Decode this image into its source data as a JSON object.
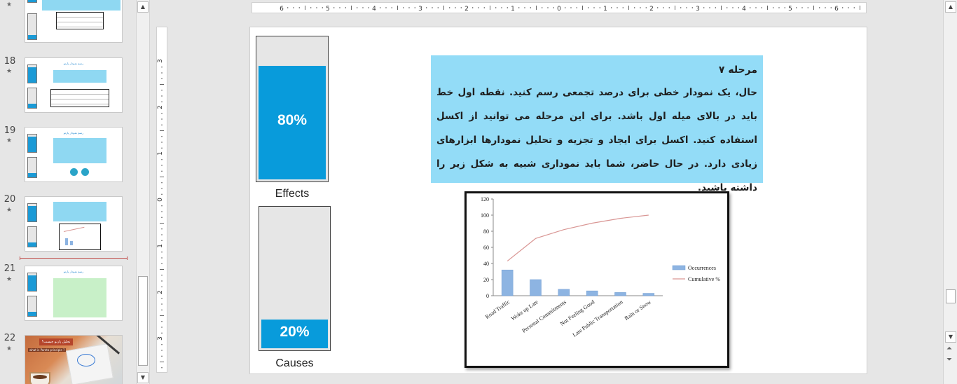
{
  "thumbnails": [
    {
      "num": "",
      "title": ""
    },
    {
      "num": "18",
      "title": "رسم نمودار پارتو"
    },
    {
      "num": "19",
      "title": "رسم نمودار پارتو"
    },
    {
      "num": "20",
      "title": ""
    },
    {
      "num": "21",
      "title": "رسم نمودار پارتو"
    },
    {
      "num": "22",
      "title": "تحلیل پارتو چیست؟",
      "subtitle": "what is Pareto principle ?"
    }
  ],
  "ruler": {
    "h_ticks": [
      "6",
      "5",
      "4",
      "3",
      "2",
      "1",
      "0",
      "1",
      "2",
      "3",
      "4",
      "5",
      "6"
    ],
    "v_ticks": [
      "3",
      "2",
      "1",
      "0",
      "1",
      "2",
      "3"
    ]
  },
  "slide": {
    "effects_bar": {
      "percent": "80%",
      "fill_fraction": 0.8,
      "label": "Effects"
    },
    "causes_bar": {
      "percent": "20%",
      "fill_fraction": 0.2,
      "label": "Causes"
    },
    "text": {
      "heading": "مرحله ۷",
      "body": "حال، یک نمودار خطی برای درصد تجمعی رسم کنید. نقطه اول خط باید در بالای میله اول باشد. برای این مرحله می توانید از اکسل استفاده کنید. اکسل برای ایجاد و تجزیه و تحلیل نمودارها ابزارهای زیادی دارد. در حال حاضر، شما باید نموداری شبیه به شکل زیر را داشته باشید."
    }
  },
  "chart_data": {
    "type": "bar",
    "categories": [
      "Road Traffic",
      "Woke up Late",
      "Personal Commitments",
      "Not Feeling Good",
      "Late Public Transportation",
      "Rain or Snow"
    ],
    "series": [
      {
        "name": "Occurrences",
        "type": "bar",
        "values": [
          32,
          20,
          8,
          6,
          4,
          3
        ],
        "color": "#8db4e2"
      },
      {
        "name": "Cumulative %",
        "type": "line",
        "values": [
          43,
          71,
          82,
          90,
          96,
          100
        ],
        "color": "#d99694"
      }
    ],
    "y_ticks": [
      "0",
      "20",
      "40",
      "60",
      "80",
      "100",
      "120"
    ],
    "ylim": [
      0,
      120
    ],
    "legend": "right"
  },
  "colors": {
    "bar_fill": "#089bdb",
    "textbox_bg": "#93dcf7",
    "insert_marker": "#c0504d"
  }
}
